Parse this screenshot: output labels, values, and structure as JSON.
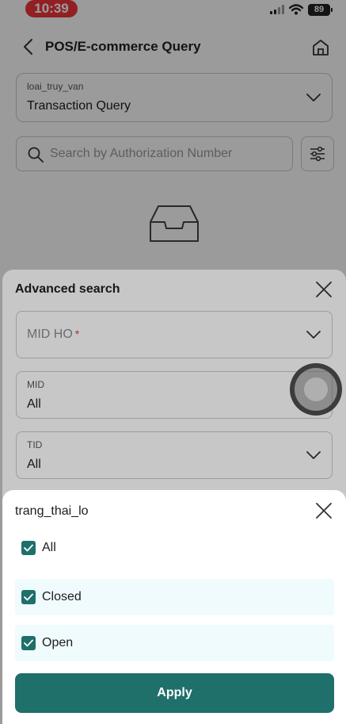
{
  "status_bar": {
    "time": "10:39",
    "battery": "89"
  },
  "header": {
    "title": "POS/E-commerce Query"
  },
  "query_type": {
    "label": "loai_truy_van",
    "value": "Transaction Query"
  },
  "search": {
    "placeholder": "Search by Authorization Number"
  },
  "advanced_search": {
    "title": "Advanced search",
    "mid_ho": {
      "placeholder": "MID HO",
      "required_mark": "*"
    },
    "mid": {
      "label": "MID",
      "value": "All"
    },
    "tid": {
      "label": "TID",
      "value": "All"
    }
  },
  "status_filter": {
    "title": "trang_thai_lo",
    "options": [
      {
        "label": "All",
        "checked": true
      },
      {
        "label": "Closed",
        "checked": true
      },
      {
        "label": "Open",
        "checked": true
      }
    ],
    "apply_label": "Apply"
  },
  "colors": {
    "primary": "#1f6f6b",
    "highlight": "#f0fbfd",
    "time_pill": "#f1353a",
    "required": "#e03a3a"
  }
}
